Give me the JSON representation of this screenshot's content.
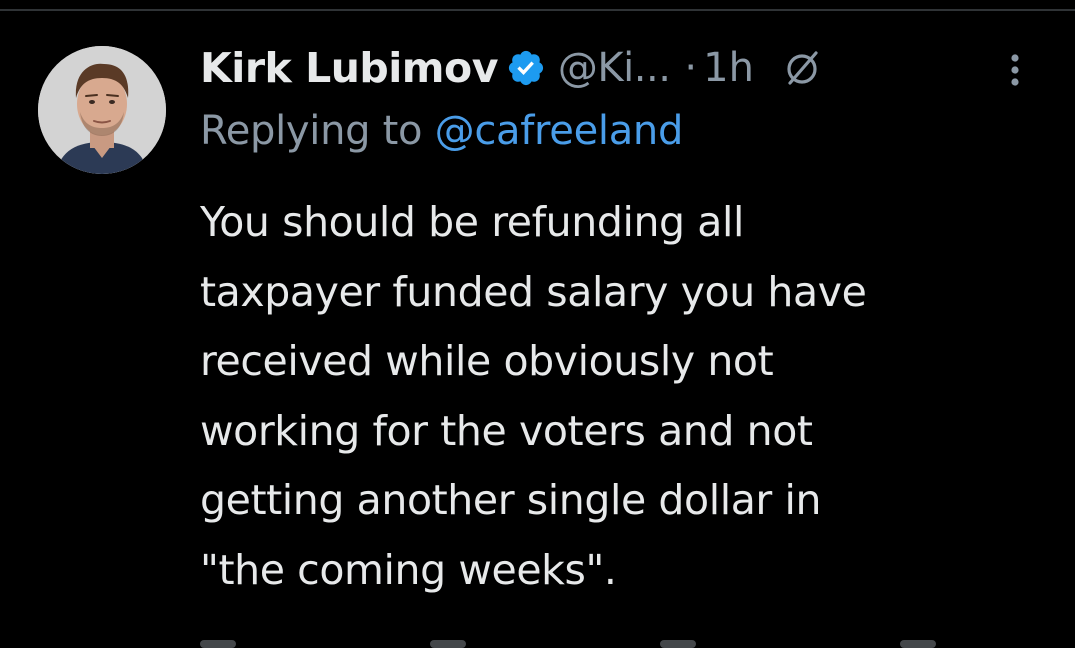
{
  "tweet": {
    "author": {
      "display_name": "Kirk Lubimov",
      "handle": "@Ki...",
      "verified": true
    },
    "separator": "·",
    "timestamp": "1h",
    "reply": {
      "prefix": "Replying to ",
      "handle": "@cafreeland"
    },
    "text_lines": [
      "You should be refunding all",
      "taxpayer funded salary you have",
      "received while obviously not",
      "working for the voters and not",
      "getting another single dollar in",
      "\"the coming weeks\"."
    ]
  },
  "icons": {
    "verified": "verified-badge-icon",
    "grok": "grok-icon",
    "more": "more-vertical-icon"
  },
  "colors": {
    "background": "#000000",
    "primary_text": "#e7e9ea",
    "secondary_text": "#8b98a5",
    "link": "#4a9de9",
    "verified_badge": "#1d9bf0"
  }
}
